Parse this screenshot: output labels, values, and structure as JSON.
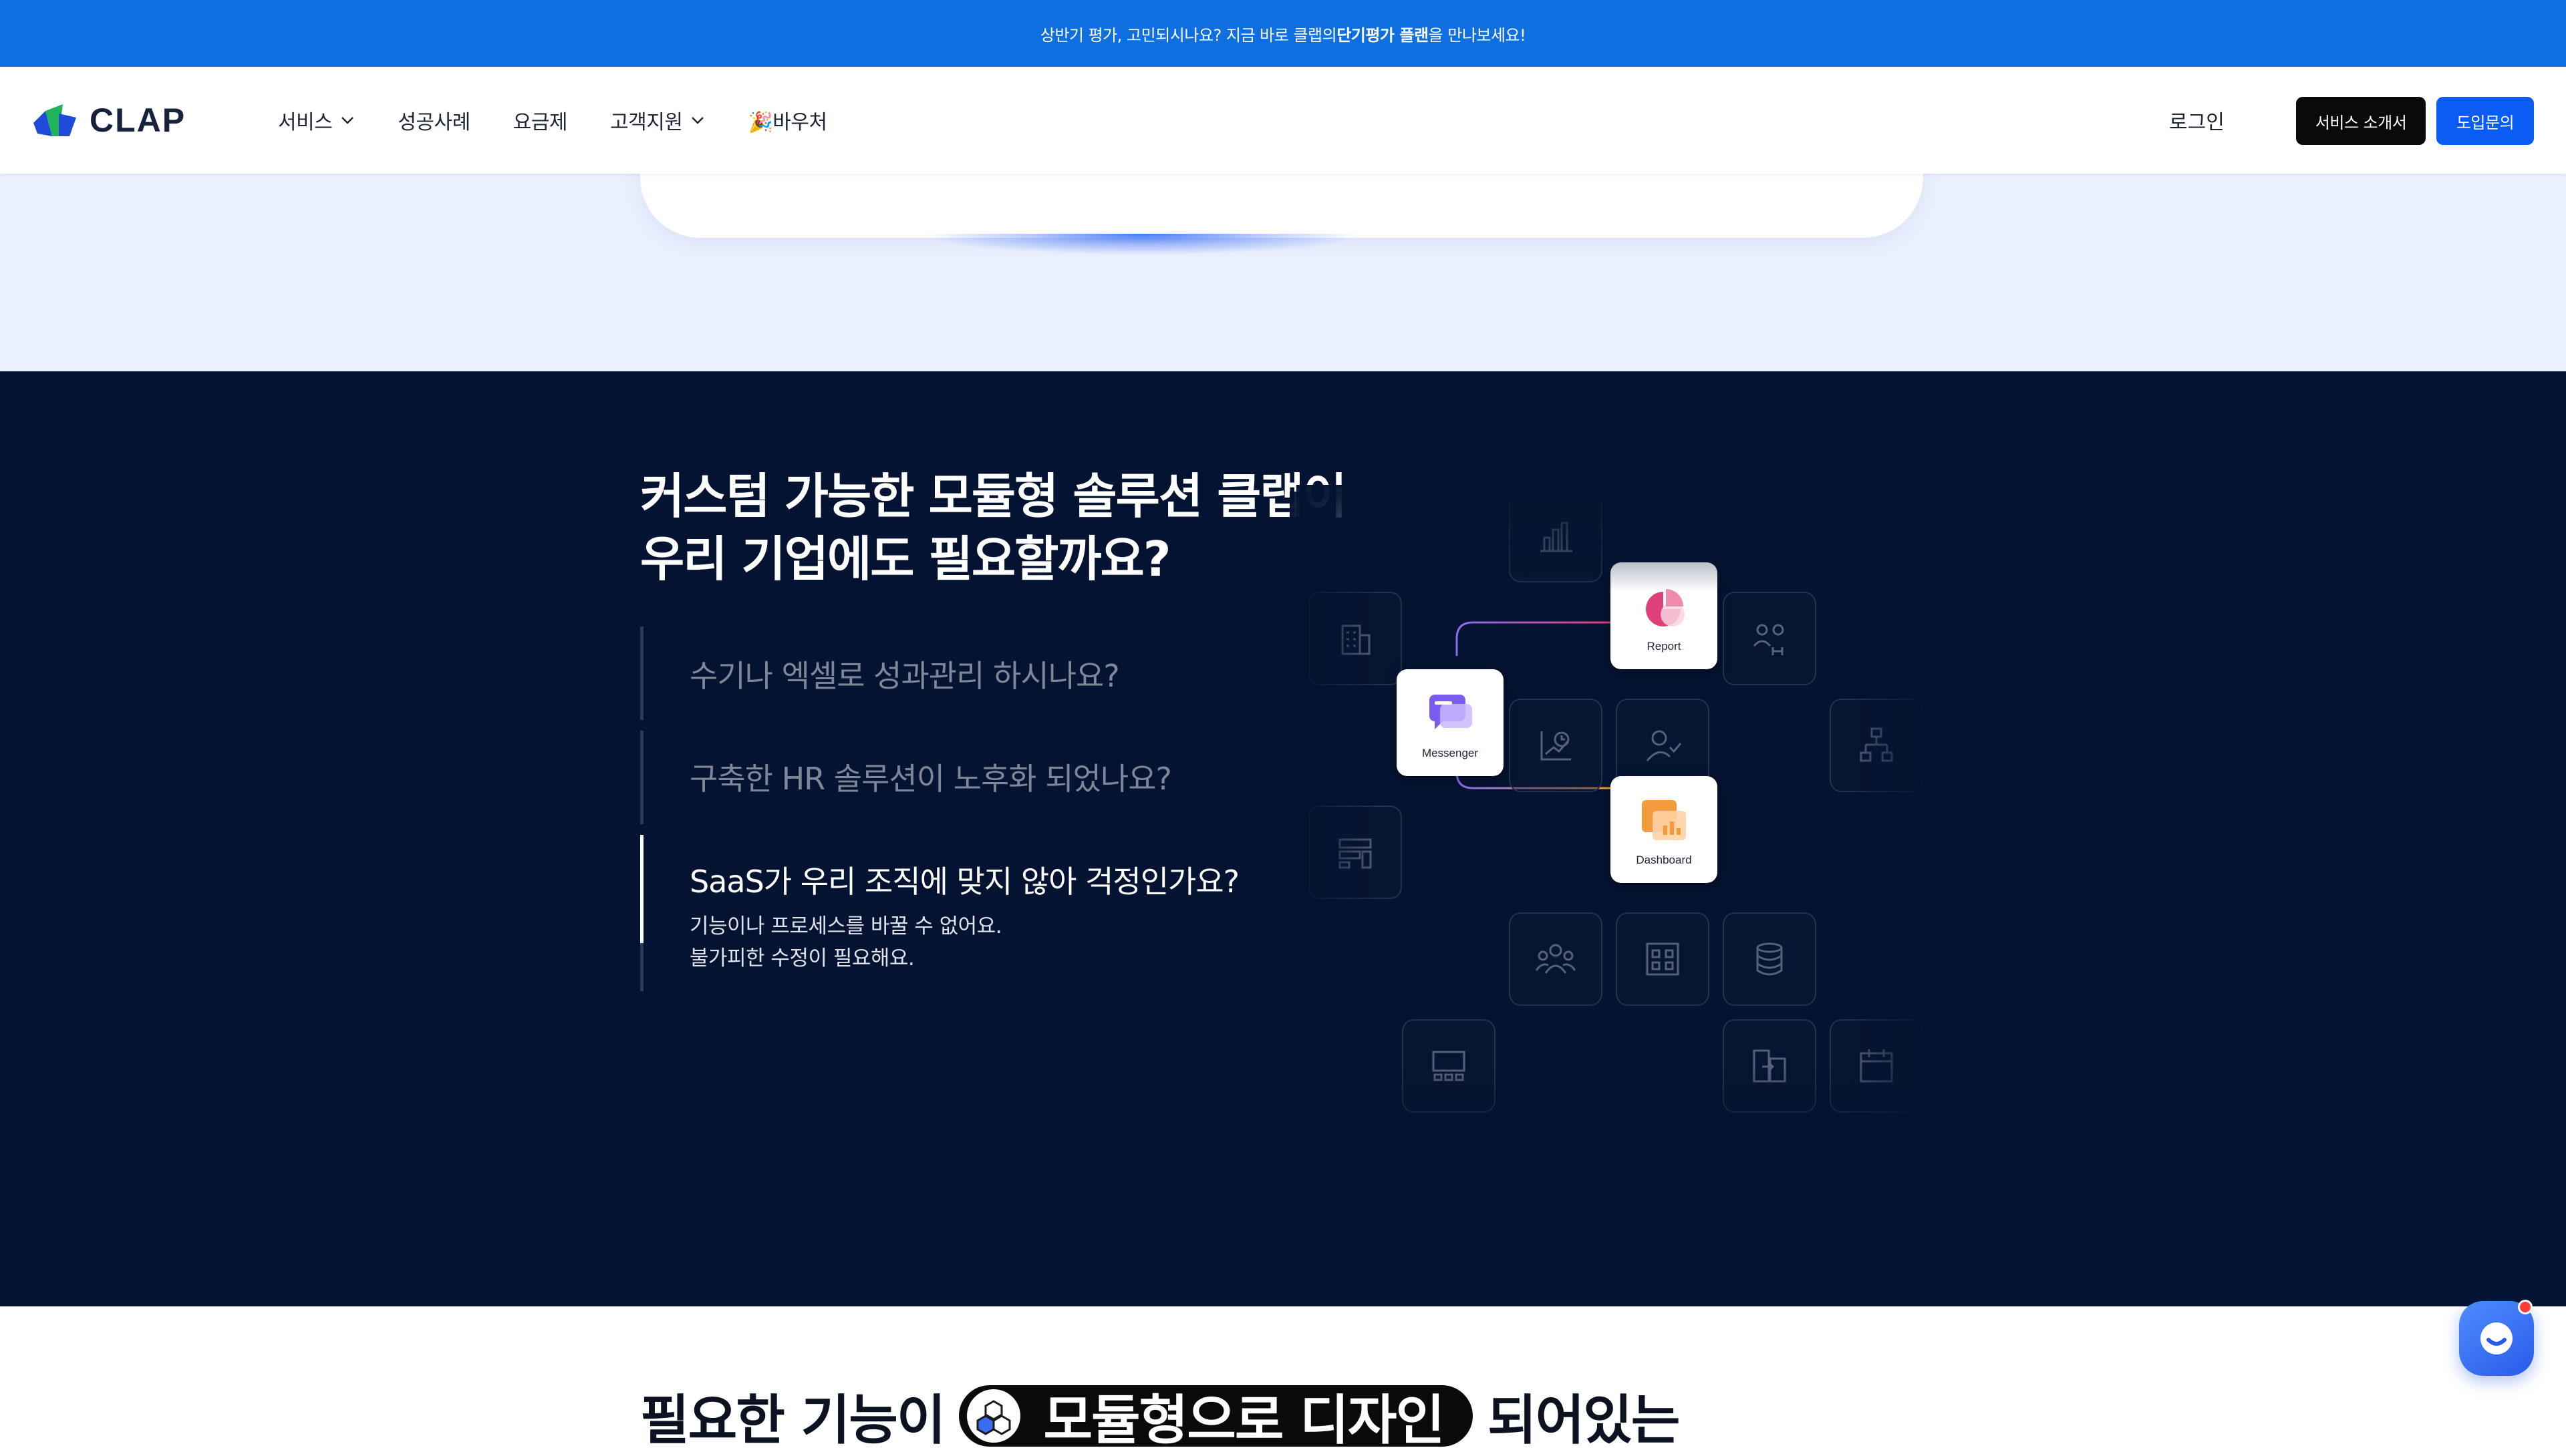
{
  "promo": {
    "text_before": "상반기 평가, 고민되시나요? 지금 바로 클랩의 ",
    "text_bold": "단기평가 플랜",
    "text_after": "을 만나보세요!"
  },
  "header": {
    "logo_text": "CLAP",
    "nav": [
      "서비스",
      "성공사례",
      "요금제",
      "고객지원",
      "🎉바우처"
    ],
    "login": "로그인",
    "intro_button": "서비스 소개서",
    "inquiry_button": "도입문의"
  },
  "dark": {
    "title_line1": "커스텀 가능한 모듈형 솔루션 클랩이",
    "title_line2": "우리 기업에도 필요할까요?",
    "questions": [
      {
        "text": "수기나 엑셀로 성과관리 하시나요?"
      },
      {
        "text": "구축한 HR 솔루션이 노후화 되었나요?"
      },
      {
        "text": "SaaS가 우리 조직에 맞지 않아 걱정인가요?",
        "desc_line1": "기능이나 프로세스를 바꿀 수 없어요.",
        "desc_line2": "불가피한 수정이 필요해요."
      }
    ],
    "cards": {
      "report": "Report",
      "messenger": "Messenger",
      "dashboard": "Dashboard"
    }
  },
  "bottom": {
    "title_before": "필요한 기능이",
    "pill_text": "모듈형으로 디자인",
    "title_after": "되어있는"
  },
  "colors": {
    "promo_bg": "#0f6fe0",
    "dark_bg": "#041331",
    "inquiry_btn": "#0a5cf5",
    "report_accent": "#e0407a",
    "messenger_accent": "#7b5cf0",
    "dashboard_accent": "#f39a3c"
  }
}
